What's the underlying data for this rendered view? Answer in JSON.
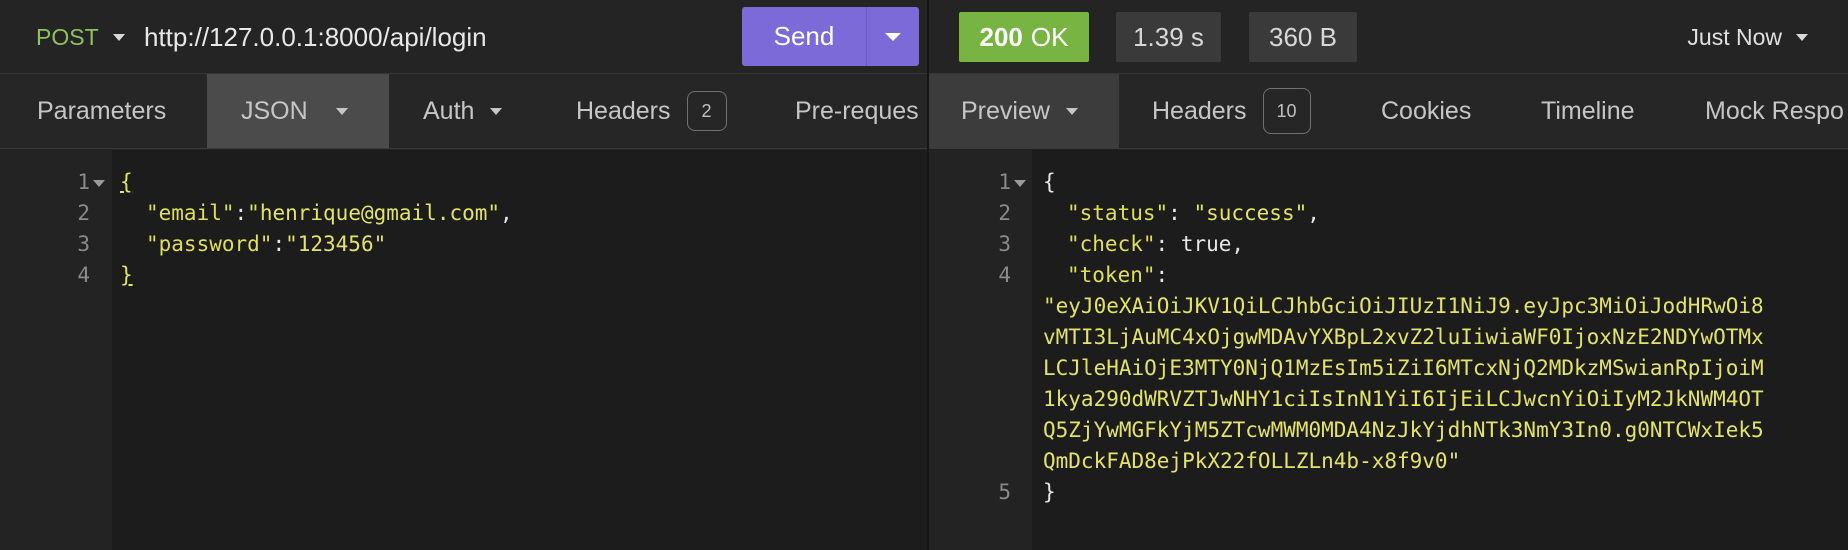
{
  "request": {
    "method": "POST",
    "url": "http://127.0.0.1:8000/api/login",
    "send_label": "Send",
    "tabs": {
      "parameters": "Parameters",
      "json": "JSON",
      "auth": "Auth",
      "headers": "Headers",
      "headers_count": "2",
      "pre_request": "Pre-reques"
    },
    "line_numbers": [
      "1",
      "2",
      "3",
      "4"
    ],
    "body": {
      "open_brace": "{",
      "email_key": "\"email\"",
      "email_value": "\"henrique@gmail.com\"",
      "password_key": "\"password\"",
      "password_value": "\"123456\"",
      "close_brace": "}"
    }
  },
  "response": {
    "status_code": "200",
    "status_text": "OK",
    "time": "1.39 s",
    "size": "360 B",
    "history_label": "Just Now",
    "tabs": {
      "preview": "Preview",
      "headers": "Headers",
      "headers_count": "10",
      "cookies": "Cookies",
      "timeline": "Timeline",
      "mock": "Mock Respo"
    },
    "line_numbers": [
      "1",
      "2",
      "3",
      "4",
      "5"
    ],
    "body": {
      "open_brace": "{",
      "status_key": "\"status\"",
      "status_value": "\"success\"",
      "check_key": "\"check\"",
      "check_value": "true",
      "token_key": "\"token\"",
      "token_lines": [
        "\"eyJ0eXAiOiJKV1QiLCJhbGciOiJIUzI1NiJ9.eyJpc3MiOiJodHRwOi8",
        "vMTI3LjAuMC4xOjgwMDAvYXBpL2xvZ2luIiwiaWF0IjoxNzE2NDYwOTMx",
        "LCJleHAiOjE3MTY0NjQ1MzEsIm5iZiI6MTcxNjQ2MDkzMSwianRpIjoiM",
        "1kya290dWRVZTJwNHY1ciIsInN1YiI6IjEiLCJwcnYiOiIyM2JkNWM4OT",
        "Q5ZjYwMGFkYjM5ZTcwMWM0MDA4NzJkYjdhNTk3NmY3In0.g0NTCWxIek5",
        "QmDckFAD8ejPkX22fOLLZLn4b-x8f9v0\""
      ],
      "close_brace": "}"
    }
  },
  "colors": {
    "method_green": "#8ec25a",
    "send_purple": "#7d6ad9",
    "status_green": "#77b442",
    "string_yellow": "#e3e36a"
  }
}
